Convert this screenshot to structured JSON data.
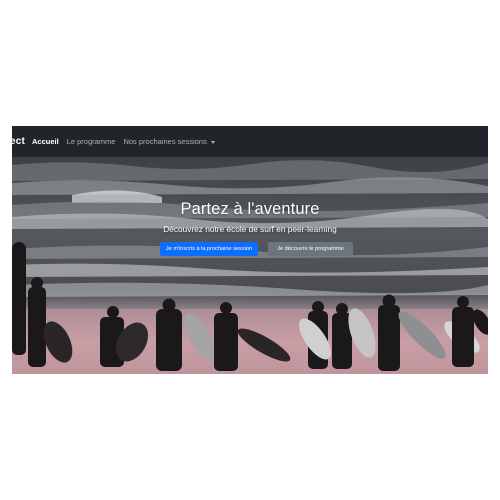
{
  "navbar": {
    "brand": "ect",
    "links": [
      {
        "label": "Accueil",
        "active": true
      },
      {
        "label": "Le programme",
        "active": false
      },
      {
        "label": "Nos prochaines sessions",
        "active": false,
        "dropdown": true
      }
    ]
  },
  "hero": {
    "title": "Partez à l'aventure",
    "subtitle": "Découvrez notre école de surf en peer-learning",
    "primary_button": "Je m'inscris à la prochaine session",
    "secondary_button": "Je découvre le programme"
  },
  "colors": {
    "navbar_bg": "#212529",
    "primary": "#0d6efd",
    "secondary": "#6c757d"
  }
}
